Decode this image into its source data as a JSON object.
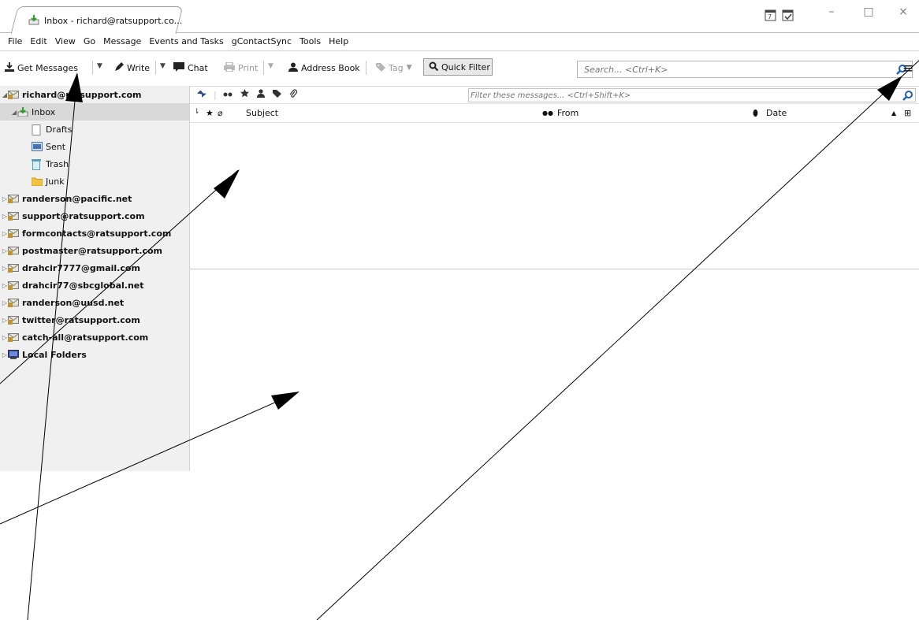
{
  "window": {
    "tab_title": "Inbox - richard@ratsupport.co...",
    "controls": [
      "–",
      "□",
      "×"
    ]
  },
  "menu": [
    "File",
    "Edit",
    "View",
    "Go",
    "Message",
    "Events and Tasks",
    "gContactSync",
    "Tools",
    "Help"
  ],
  "toolbar": {
    "get_messages": "Get Messages",
    "write": "Write",
    "chat": "Chat",
    "print": "Print",
    "address_book": "Address Book",
    "tag": "Tag",
    "quick_filter": "Quick Filter",
    "search_placeholder": "Search... <Ctrl+K>"
  },
  "folders": {
    "account": "richard@ratsupport.com",
    "inbox": "Inbox",
    "drafts": "Drafts",
    "sent": "Sent",
    "trash": "Trash",
    "junk": "Junk",
    "other_accounts": [
      "randerson@pacific.net",
      "support@ratsupport.com",
      "formcontacts@ratsupport.com",
      "postmaster@ratsupport.com",
      "drahcir7777@gmail.com",
      "drahcir77@sbcglobal.net",
      "randerson@uusd.net",
      "twitter@ratsupport.com",
      "catch-all@ratsupport.com",
      "Local Folders"
    ]
  },
  "message_list": {
    "filter_placeholder": "Filter these messages... <Ctrl+Shift+K>",
    "columns": {
      "subject": "Subject",
      "from": "From",
      "date": "Date"
    }
  }
}
